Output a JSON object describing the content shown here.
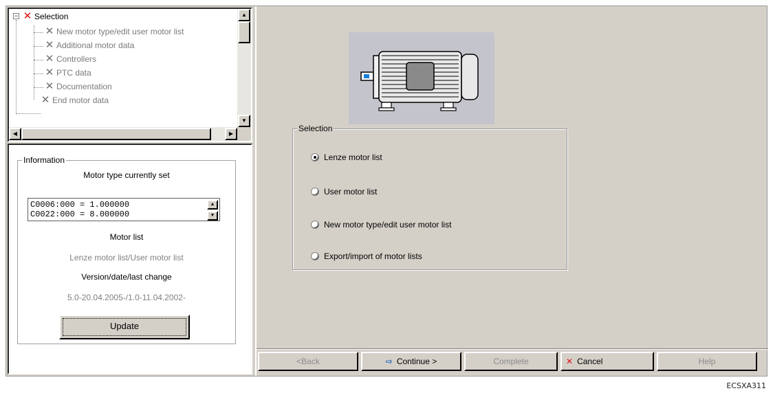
{
  "tree": {
    "items": [
      {
        "label": "Selection",
        "icon": "x-red-icon"
      },
      {
        "label": "New motor type/edit user motor list",
        "icon": "x-gray-icon"
      },
      {
        "label": "Additional motor data",
        "icon": "x-gray-icon"
      },
      {
        "label": "Controllers",
        "icon": "x-gray-icon"
      },
      {
        "label": "PTC data",
        "icon": "x-gray-icon"
      },
      {
        "label": "Documentation",
        "icon": "x-gray-icon"
      },
      {
        "label": "End motor data",
        "icon": "x-gray-icon"
      }
    ]
  },
  "info": {
    "legend": "Information",
    "motor_type_heading": "Motor type currently set",
    "code_lines": [
      "C0006:000 = 1.000000",
      "C0022:000 = 8.000000"
    ],
    "motor_list_heading": "Motor list",
    "motor_list_value": "Lenze motor list/User motor list",
    "version_heading": "Version/date/last change",
    "version_value": "5.0-20.04.2005-/1.0-11.04.2002-",
    "update_label": "Update"
  },
  "selection": {
    "legend": "Selection",
    "options": [
      {
        "label": "Lenze motor list",
        "checked": true
      },
      {
        "label": "User motor list",
        "checked": false
      },
      {
        "label": "New motor type/edit user motor list",
        "checked": false
      },
      {
        "label": "Export/import of motor lists",
        "checked": false
      }
    ]
  },
  "buttons": {
    "back": "<Back",
    "continue": "Continue >",
    "complete": "Complete",
    "cancel": "Cancel",
    "help": "Help"
  },
  "caption": "ECSXA311",
  "colors": {
    "window_bg": "#d4d0c8",
    "error_red": "#e01010",
    "motor_bg": "#c4c4cc"
  }
}
